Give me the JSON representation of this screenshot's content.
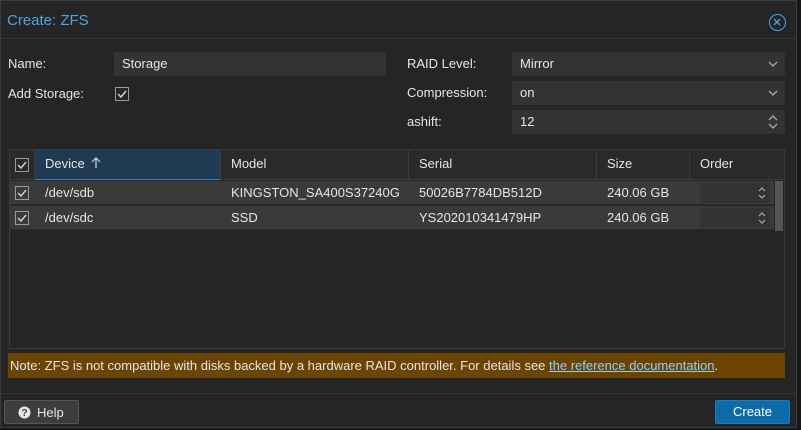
{
  "dialog": {
    "title": "Create: ZFS"
  },
  "form": {
    "name_label": "Name:",
    "name_value": "Storage",
    "add_storage_label": "Add Storage:",
    "add_storage_checked": true,
    "raid_label": "RAID Level:",
    "raid_value": "Mirror",
    "compression_label": "Compression:",
    "compression_value": "on",
    "ashift_label": "ashift:",
    "ashift_value": "12"
  },
  "grid": {
    "columns": [
      "Device",
      "Model",
      "Serial",
      "Size",
      "Order"
    ],
    "sorted_column": "Device",
    "rows": [
      {
        "checked": true,
        "device": "/dev/sdb",
        "model": "KINGSTON_SA400S37240G",
        "serial": "50026B7784DB512D",
        "size": "240.06 GB"
      },
      {
        "checked": true,
        "device": "/dev/sdc",
        "model": "SSD",
        "serial": "YS202010341479HP",
        "size": "240.06 GB"
      }
    ]
  },
  "note": {
    "text": "Note: ZFS is not compatible with disks backed by a hardware RAID controller. For details see ",
    "link_text": "the reference documentation",
    "suffix": "."
  },
  "footer": {
    "help_label": "Help",
    "create_label": "Create"
  },
  "colors": {
    "accent": "#4fa3e0",
    "primary_button": "#0d6aa9",
    "warning_bg": "#6b4400",
    "link": "#8fd0ff"
  }
}
